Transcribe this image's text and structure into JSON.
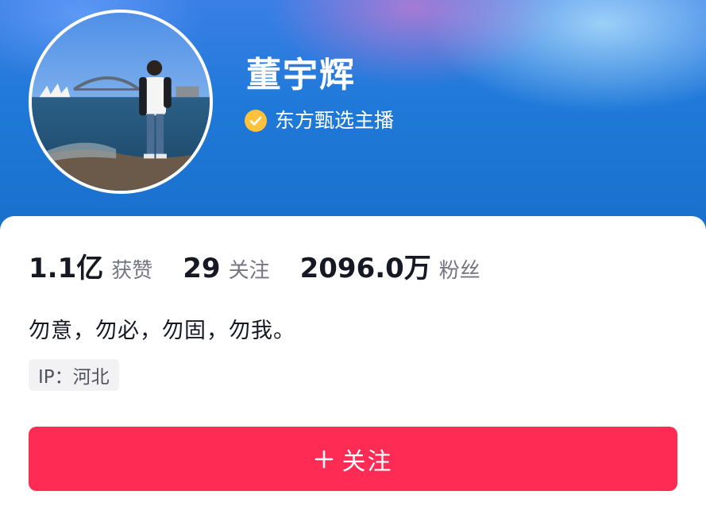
{
  "profile": {
    "name": "董宇辉",
    "verified_icon": "verified-check-icon",
    "verification_text": "东方甄选主播"
  },
  "stats": [
    {
      "value": "1.1亿",
      "label": "获赞"
    },
    {
      "value": "29",
      "label": "关注"
    },
    {
      "value": "2096.0万",
      "label": "粉丝"
    }
  ],
  "bio": "勿意，勿必，勿固，勿我。",
  "ip_location": "IP：河北",
  "follow_button": {
    "label": "关注",
    "icon": "plus-icon"
  },
  "colors": {
    "banner_blue": "#1f79d8",
    "verify_gold": "#ffc23a",
    "follow_red": "#fe2c55",
    "text_dark": "#161823",
    "text_gray": "#757680"
  }
}
